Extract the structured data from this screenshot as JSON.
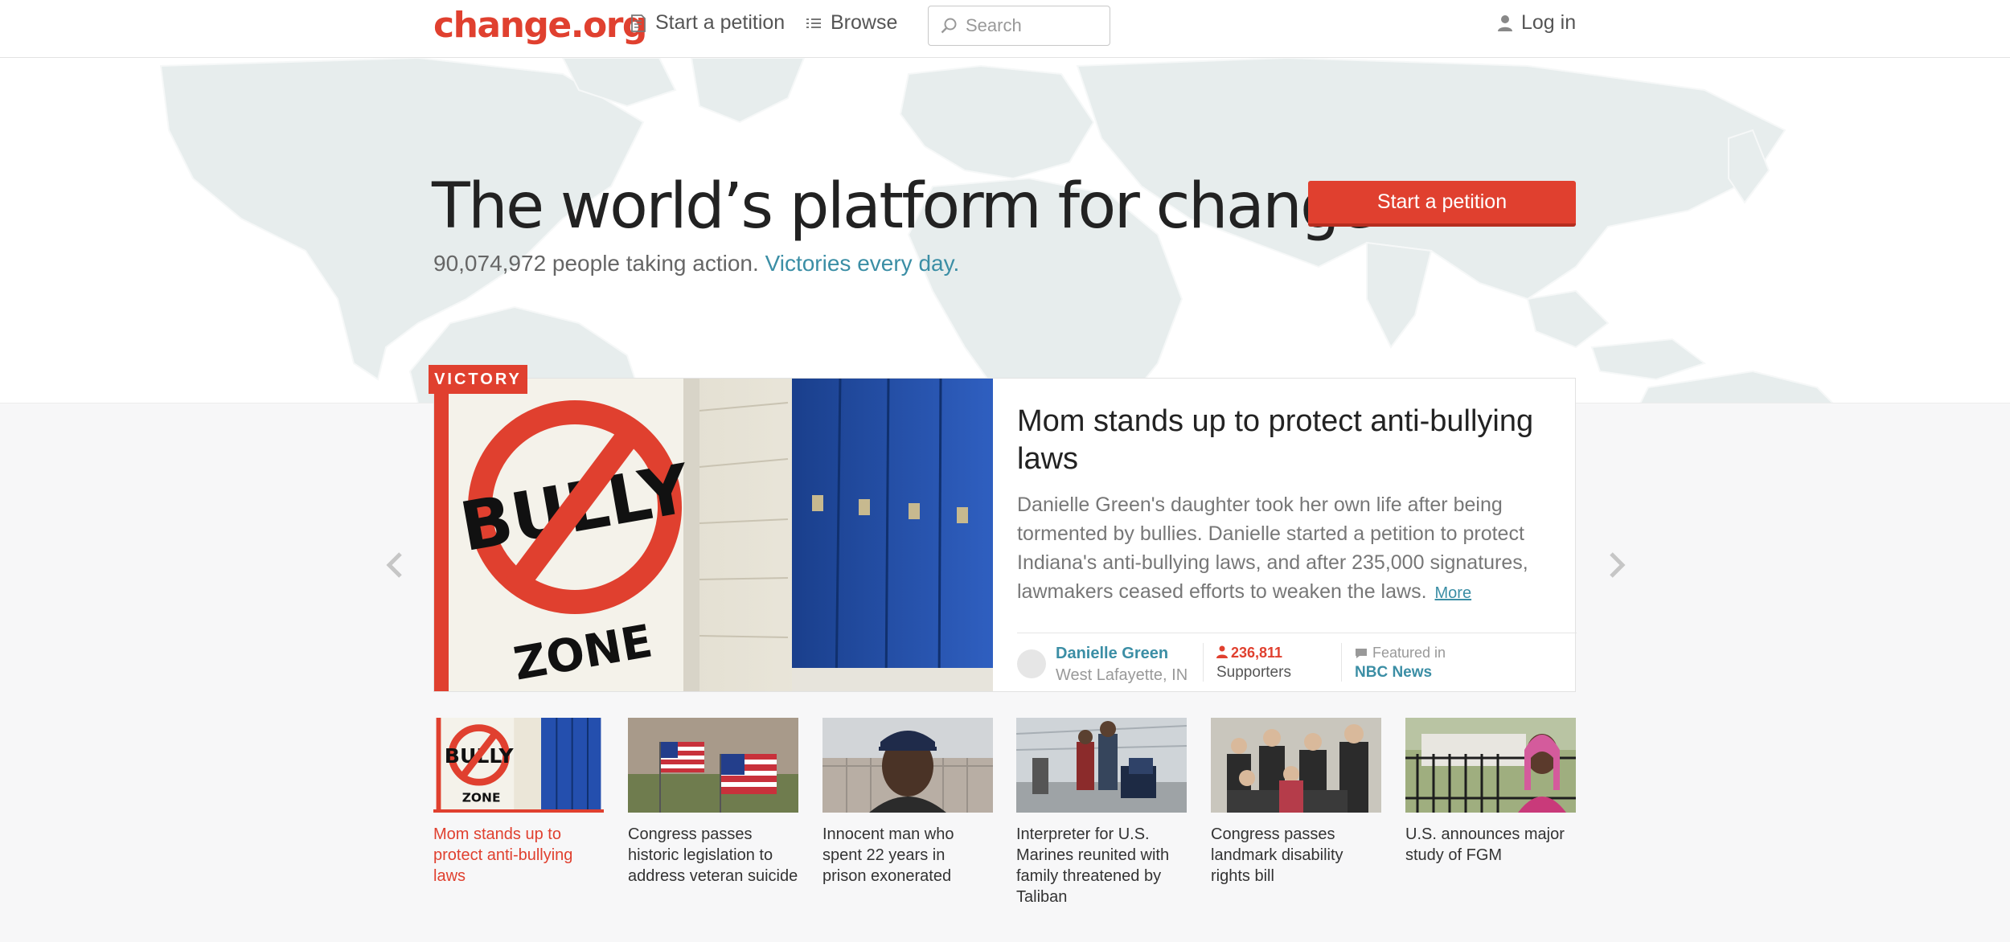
{
  "header": {
    "logo": "change.org",
    "nav": {
      "start_petition": "Start a petition",
      "browse": "Browse"
    },
    "search": {
      "placeholder": "Search"
    },
    "login": "Log in"
  },
  "hero": {
    "title": "The world’s platform for change",
    "people_count": "90,074,972 people taking action.",
    "victories_link": "Victories every day.",
    "cta": "Start a petition"
  },
  "featured": {
    "tag": "VICTORY",
    "title": "Mom stands up to protect anti-bullying laws",
    "description": "Danielle Green's daughter took her own life after being tormented by bullies. Danielle started a petition to protect Indiana's anti-bullying laws, and after 235,000 signatures, lawmakers ceased efforts to weaken the laws.",
    "more": "More",
    "author": {
      "name": "Danielle Green",
      "location": "West Lafayette, IN"
    },
    "supporters": {
      "count": "236,811",
      "label": "Supporters"
    },
    "featured_in": {
      "label": "Featured in",
      "source": "NBC News"
    },
    "image_text": [
      "BULLY",
      "ZONE"
    ]
  },
  "thumbnails": [
    {
      "caption": "Mom stands up to protect anti-bullying laws",
      "active": true
    },
    {
      "caption": "Congress passes historic legislation to address veteran suicide",
      "active": false
    },
    {
      "caption": "Innocent man who spent 22 years in prison exonerated",
      "active": false
    },
    {
      "caption": "Interpreter for U.S. Marines reunited with family threatened by Taliban",
      "active": false
    },
    {
      "caption": "Congress passes landmark disability rights bill",
      "active": false
    },
    {
      "caption": "U.S. announces major study of FGM",
      "active": false
    }
  ],
  "colors": {
    "brand": "#e0402f",
    "link": "#3b8ea5"
  },
  "icons": {
    "nav_start": "petition-document-icon",
    "nav_browse": "list-icon",
    "search": "search-icon",
    "login": "user-icon",
    "supporters": "person-icon",
    "featured": "speech-bubble-icon",
    "prev": "chevron-left-icon",
    "next": "chevron-right-icon"
  }
}
